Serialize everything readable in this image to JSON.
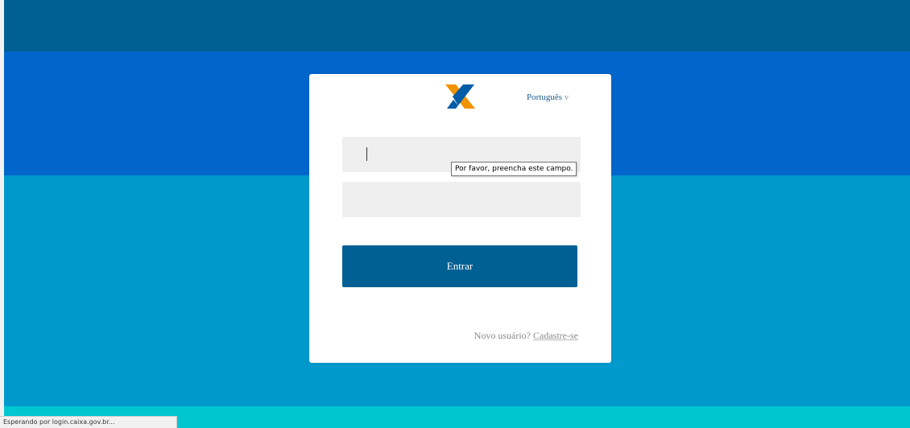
{
  "header": {
    "language_label": "Português",
    "language_chevron": "v"
  },
  "logo": {
    "icon": "caixa-x-logo",
    "colors": {
      "orange": "#f39200",
      "blue": "#005ca9"
    }
  },
  "form": {
    "user_value": "",
    "password_value": "",
    "validation_tooltip": "Por favor, preencha este campo.",
    "submit_label": "Entrar"
  },
  "footer": {
    "new_user_text": "Novo usuário?",
    "signup_link": "Cadastre-se"
  },
  "status": {
    "text": "Esperando por login.caixa.gov.br..."
  },
  "colors": {
    "top_band": "#005f93",
    "blue_band": "#0066cc",
    "cyan_band": "#0099cc",
    "bottom_band": "#00c7cf",
    "button": "#005f93"
  }
}
